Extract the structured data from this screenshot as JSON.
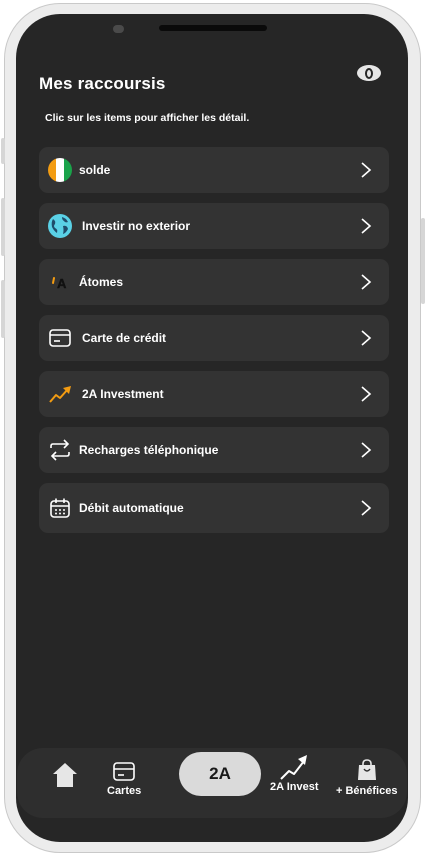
{
  "header": {
    "title": "Mes  raccoursis",
    "subtitle": "Clic sur les items pour afficher les détail.",
    "visibility_icon": "eye-toggle-icon"
  },
  "shortcuts": [
    {
      "label": "solde",
      "icon": "ivory-coast-flag-icon"
    },
    {
      "label": "Investir no exterior",
      "icon": "globe-icon"
    },
    {
      "label": "Átomes",
      "icon": "atomes-logo-icon"
    },
    {
      "label": "Carte de crédit",
      "icon": "credit-card-icon"
    },
    {
      "label": "2A Investment",
      "icon": "trend-up-icon"
    },
    {
      "label": "Recharges téléphonique",
      "icon": "exchange-arrows-icon"
    },
    {
      "label": "Débit automatique",
      "icon": "calendar-icon"
    }
  ],
  "atomes_logo": "A",
  "bottom_nav": {
    "home": {
      "icon": "home-icon"
    },
    "cartes": {
      "label": "Cartes",
      "icon": "card-icon"
    },
    "center": {
      "label": "2A"
    },
    "invest": {
      "label": "2A Invest",
      "icon": "trend-up-icon"
    },
    "benefices": {
      "label": "+ Bénéfices",
      "icon": "shopping-bag-icon"
    }
  },
  "colors": {
    "screen_background": "#262626",
    "item_background": "#333333",
    "accent_orange": "#f39c12",
    "flag_green": "#1aa34a",
    "globe_cyan": "#5ad1e6"
  }
}
